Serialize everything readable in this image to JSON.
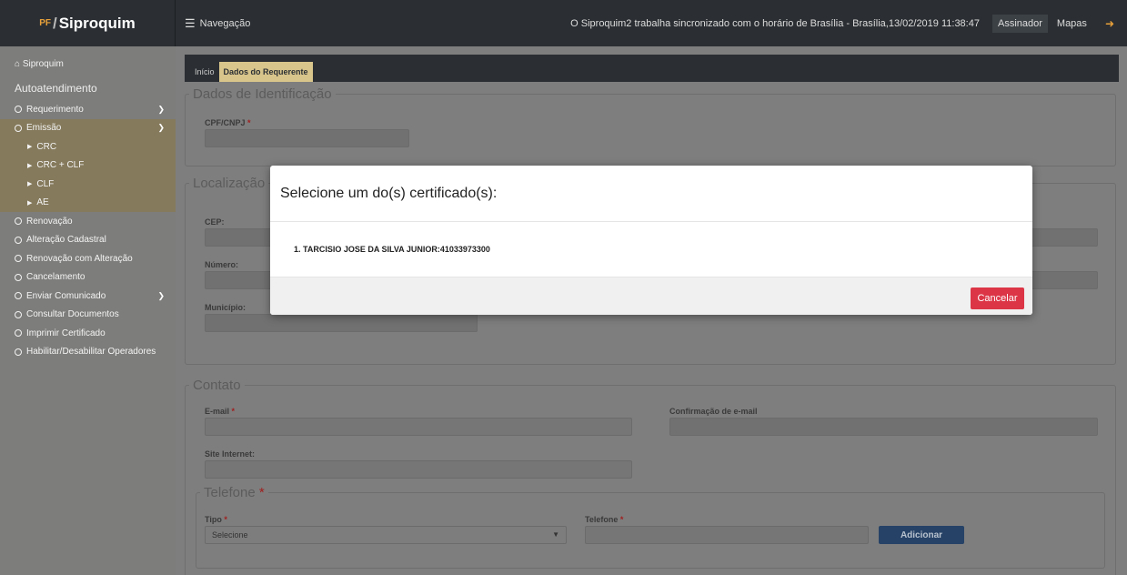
{
  "header": {
    "brand_prefix": "PF",
    "brand_sep": "/",
    "brand_name": "Siproquim",
    "nav_label": "Navegação",
    "sync_text": "O Siproquim2 trabalha sincronizado com o horário de Brasília - Brasília,13/02/2019 11:38:47",
    "signer_label": "Assinador",
    "maps_label": "Mapas",
    "logout_icon": "sign-out-icon"
  },
  "sidebar": {
    "home_label": "Siproquim",
    "section_title": "Autoatendimento",
    "items": [
      {
        "label": "Requerimento",
        "chevron": "down"
      },
      {
        "label": "Emissão",
        "chevron": "down"
      },
      {
        "label": "Renovação"
      },
      {
        "label": "Alteração Cadastral"
      },
      {
        "label": "Renovação com Alteração"
      },
      {
        "label": "Cancelamento"
      },
      {
        "label": "Enviar Comunicado",
        "chevron": "right"
      },
      {
        "label": "Consultar Documentos"
      },
      {
        "label": "Imprimir Certificado"
      },
      {
        "label": "Habilitar/Desabilitar Operadores"
      }
    ],
    "emissao_sub": [
      "CRC",
      "CRC + CLF",
      "CLF",
      "AE"
    ]
  },
  "tabs": [
    {
      "label": "Início",
      "active": false
    },
    {
      "label": "Dados do Requerente",
      "active": true
    }
  ],
  "identificacao": {
    "legend": "Dados de Identificação",
    "cpf_label": "CPF/CNPJ",
    "required_mark": "*"
  },
  "localizacao": {
    "legend": "Localização",
    "cep_label": "CEP:",
    "numero_label": "Número:",
    "municipio_label": "Município:"
  },
  "contato": {
    "legend": "Contato",
    "email_label": "E-mail",
    "confirm_email_label": "Confirmação de e-mail",
    "site_label": "Site Internet:",
    "telefone_legend": "Telefone",
    "tipo_label": "Tipo",
    "tipo_value": "Selecione",
    "telefone_label": "Telefone",
    "add_button": "Adicionar"
  },
  "modal": {
    "title": "Selecione um do(s) certificado(s):",
    "certificate": "1. TARCISIO JOSE DA SILVA JUNIOR:41033973300",
    "cancel_button": "Cancelar"
  },
  "colors": {
    "cancel": "#dc3545",
    "add": "#264266",
    "active_tab": "#d8c58c"
  }
}
